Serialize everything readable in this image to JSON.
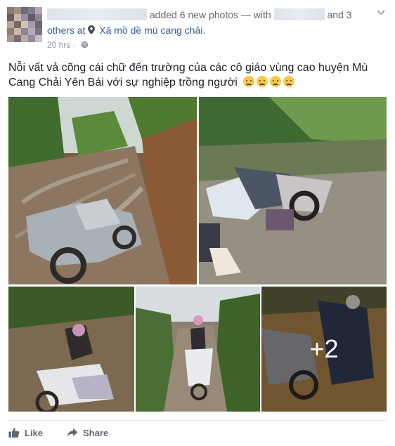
{
  "post": {
    "action_text": "added 6 new photos — with",
    "and_text": "and 3",
    "others_text": "others at",
    "location": "Xã mồ dề mù cang chải.",
    "timestamp": "20 hrs ·",
    "caption": "Nỗi vất vả cõng cái chữ đến trường của các cô giáo vùng cao huyện Mù Cang Chải Yên Bái với sự nghiệp trồng người",
    "emoji_count": 4,
    "more_photos_label": "+2"
  },
  "icons": {
    "location": "location-pin-icon",
    "privacy": "globe-icon",
    "menu": "chevron-down-icon",
    "like": "thumbs-up-icon",
    "share": "share-arrow-icon"
  },
  "actions": {
    "like_label": "Like",
    "share_label": "Share"
  },
  "colors": {
    "link": "#365899",
    "meta": "#90949c",
    "text": "#1d2129"
  }
}
